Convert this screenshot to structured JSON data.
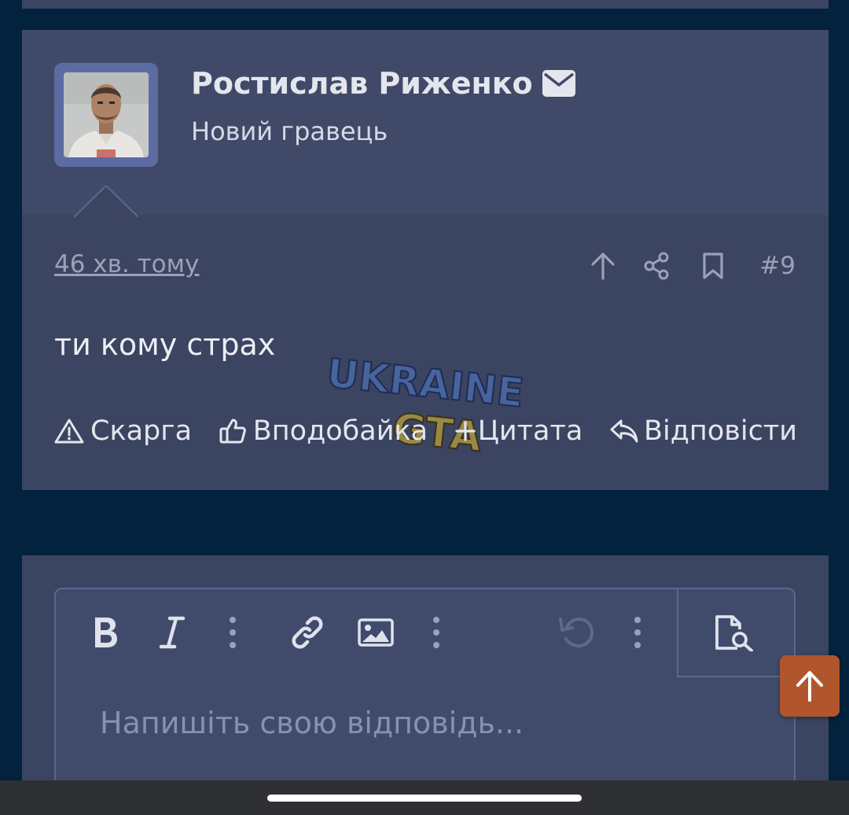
{
  "post": {
    "author": {
      "name": "Ростислав Риженко",
      "title": "Новий гравець",
      "avatar_icon": "avatar-portrait",
      "message_icon": "envelope-icon"
    },
    "date": "46 хв. тому",
    "number": "#9",
    "body": "ти кому страх",
    "actions": {
      "report": "Скарга",
      "like": "Вподобайка",
      "quote": "Цитата",
      "reply": "Відповісти"
    }
  },
  "watermark": {
    "line1": "UKRAINE",
    "line2": "GTA"
  },
  "editor": {
    "placeholder": "Напишіть свою відповідь..."
  },
  "colors": {
    "page_bg": "#02223d",
    "card_bg": "#3b4460",
    "accent": "#b0552c",
    "avatar_frame": "#5d6ba3"
  }
}
